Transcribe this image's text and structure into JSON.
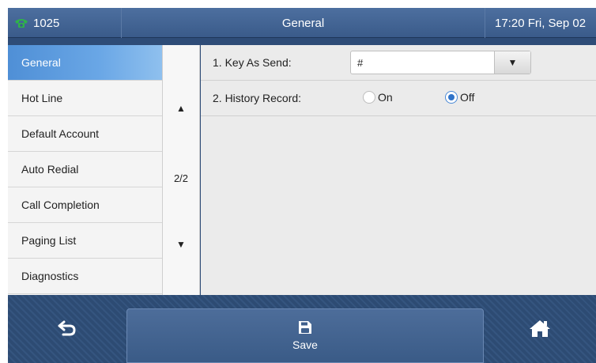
{
  "status_bar": {
    "account": "1025",
    "title": "General",
    "clock": "17:20 Fri, Sep 02"
  },
  "menu": {
    "items": [
      {
        "label": "General",
        "active": true
      },
      {
        "label": "Hot Line",
        "active": false
      },
      {
        "label": "Default Account",
        "active": false
      },
      {
        "label": "Auto Redial",
        "active": false
      },
      {
        "label": "Call Completion",
        "active": false
      },
      {
        "label": "Paging List",
        "active": false
      },
      {
        "label": "Diagnostics",
        "active": false
      }
    ]
  },
  "pager": {
    "up_icon": "▲",
    "page": "2/2",
    "down_icon": "▼"
  },
  "settings": {
    "key_as_send": {
      "label": "1. Key As Send:",
      "value": "#",
      "dropdown_icon": "▼"
    },
    "history_record": {
      "label": "2. History Record:",
      "options": [
        {
          "label": "On",
          "checked": false
        },
        {
          "label": "Off",
          "checked": true
        }
      ]
    }
  },
  "softkeys": {
    "back_icon": "back-arrow-icon",
    "save_label": "Save",
    "save_icon": "floppy-disk-icon",
    "home_icon": "home-icon"
  },
  "colors": {
    "accent": "#4f8fd6",
    "bar": "#2e4c77",
    "phone_icon": "#2fb24a"
  }
}
